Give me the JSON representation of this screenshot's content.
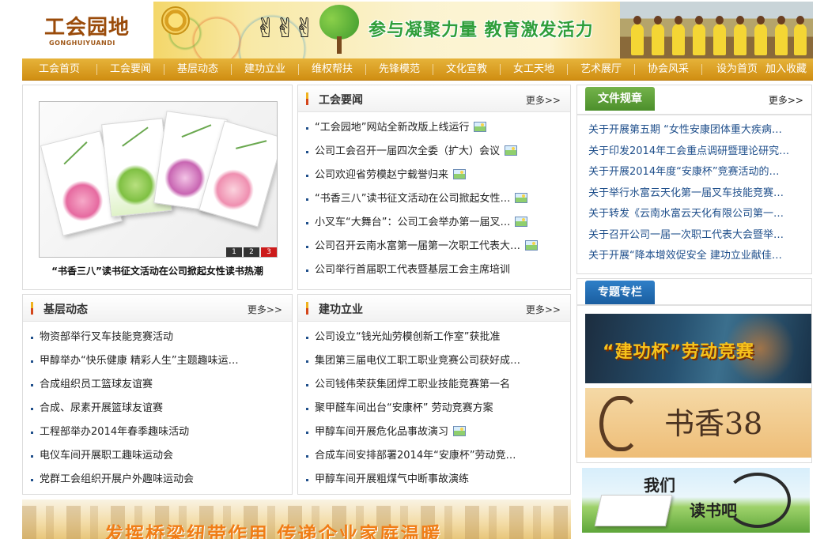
{
  "header": {
    "logo_cn": "工会园地",
    "logo_en": "GONGHUIYUANDI",
    "slogan": "参与凝聚力量 教育激发活力"
  },
  "nav": {
    "items": [
      "工会首页",
      "工会要闻",
      "基层动态",
      "建功立业",
      "维权帮扶",
      "先锋模范",
      "文化宣教",
      "女工天地",
      "艺术展厅",
      "协会风采"
    ],
    "set_home": "设为首页",
    "bookmark": "加入收藏"
  },
  "feature": {
    "caption": "“书香三八”读书征文活动在公司掀起女性读书热潮",
    "pages": [
      "1",
      "2",
      "3"
    ],
    "active_page": "3"
  },
  "news": {
    "title": "工会要闻",
    "more": "更多>>",
    "items": [
      {
        "text": "“工会园地”网站全新改版上线运行",
        "has_image": true
      },
      {
        "text": "公司工会召开一届四次全委（扩大）会议",
        "has_image": true
      },
      {
        "text": "公司欢迎省劳模赵宁载誉归来",
        "has_image": true
      },
      {
        "text": "“书香三八”读书征文活动在公司掀起女性…",
        "has_image": true
      },
      {
        "text": "小叉车“大舞台”：公司工会举办第一届叉…",
        "has_image": true
      },
      {
        "text": "公司召开云南水富第一届第一次职工代表大…",
        "has_image": true
      },
      {
        "text": "公司举行首届职工代表暨基层工会主席培训",
        "has_image": false
      }
    ]
  },
  "docs": {
    "title": "文件规章",
    "more": "更多>>",
    "items": [
      "关于开展第五期 “女性安康团体重大疾病…",
      "关于印发2014年工会重点调研暨理论研究…",
      "关于开展2014年度“安康杯”竞赛活动的…",
      "关于举行水富云天化第一届叉车技能竞赛…",
      "关于转发《云南水富云天化有限公司第一…",
      "关于召开公司一届一次职工代表大会暨举…",
      "关于开展“降本增效促安全 建功立业献佳…"
    ]
  },
  "grassroots": {
    "title": "基层动态",
    "more": "更多>>",
    "items": [
      "物资部举行叉车技能竞赛活动",
      "甲醇举办“快乐健康 精彩人生”主题趣味运…",
      "合成组织员工篮球友谊赛",
      "合成、尿素开展篮球友谊赛",
      "工程部举办2014年春季趣味活动",
      "电仪车间开展职工趣味运动会",
      "党群工会组织开展户外趣味运动会"
    ]
  },
  "merit": {
    "title": "建功立业",
    "more": "更多>>",
    "items": [
      {
        "text": "公司设立“钱光灿劳模创新工作室”获批准",
        "has_image": false
      },
      {
        "text": "集团第三届电仪工职工职业竞赛公司获好成…",
        "has_image": false
      },
      {
        "text": "公司钱伟荣获集团焊工职业技能竞赛第一名",
        "has_image": false
      },
      {
        "text": "聚甲醛车间出台“安康杯” 劳动竞赛方案",
        "has_image": false
      },
      {
        "text": "甲醇车间开展危化品事故演习",
        "has_image": true
      },
      {
        "text": "合成车间安排部署2014年“安康杯”劳动竞…",
        "has_image": false
      },
      {
        "text": "甲醇车间开展粗煤气中断事故演练",
        "has_image": false
      }
    ]
  },
  "special": {
    "title": "专题专栏",
    "promo1": "“建功杯”劳动竞赛",
    "promo2": "书香38"
  },
  "reading_banner": {
    "line1": "我们",
    "line2": "读书吧"
  },
  "bottom_banner": {
    "text": "发挥桥梁纽带作用  传递企业家庭温暖"
  },
  "colors": {
    "nav_top": "#e6b33a",
    "nav_bottom": "#d08e12",
    "link_blue": "#1f4f8b",
    "tab_green": "#5a9c35",
    "tab_blue": "#2572b8"
  }
}
